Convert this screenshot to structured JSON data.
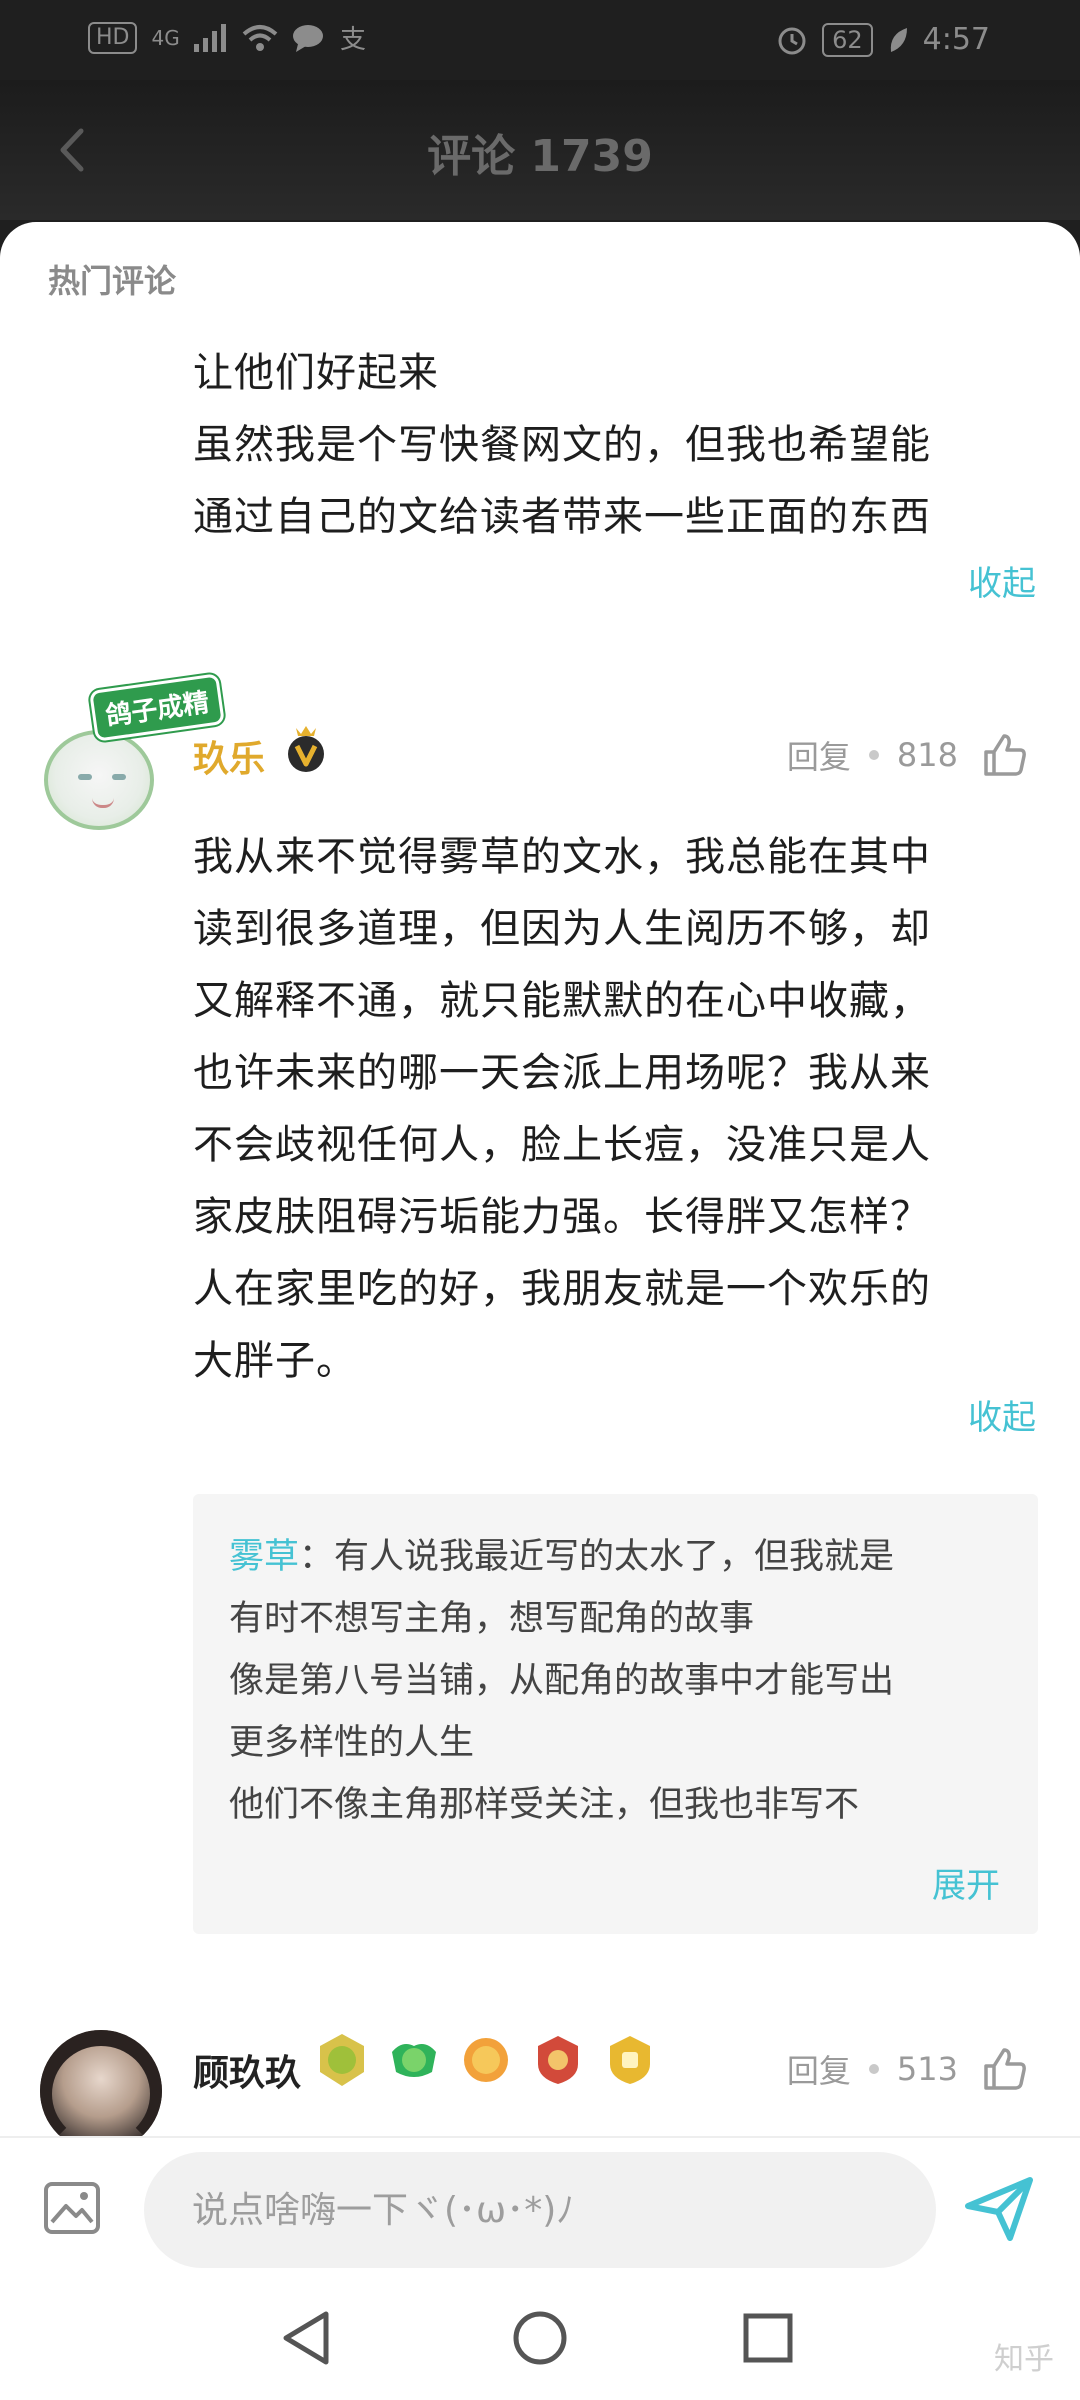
{
  "status_bar": {
    "hd_label": "HD",
    "network": "4G",
    "battery": "62",
    "time": "4:57"
  },
  "header": {
    "title": "评论 1739"
  },
  "section": {
    "hot_label": "热门评论"
  },
  "expanded_comment": {
    "lines": [
      "让他们好起来",
      "虽然我是个写快餐网文的，但我也希望能",
      "通过自己的文给读者带来一些正面的东西"
    ],
    "collapse_label": "收起"
  },
  "comment1": {
    "avatar_badge": "鸽子成精",
    "username": "玖乐",
    "reply_label": "回复",
    "likes": "818",
    "lines": [
      "我从来不觉得雾草的文水，我总能在其中",
      "读到很多道理，但因为人生阅历不够，却",
      "又解释不通，就只能默默的在心中收藏，",
      "也许未来的哪一天会派上用场呢？我从来",
      "不会歧视任何人，脸上长痘，没准只是人",
      "家皮肤阻碍污垢能力强。长得胖又怎样？",
      "人在家里吃的好，我朋友就是一个欢乐的",
      "大胖子。"
    ],
    "collapse_label": "收起",
    "reply": {
      "author": "雾草",
      "separator": "：",
      "first_line_text": "有人说我最近写的太水了，但我就是",
      "lines": [
        "有时不想写主角，想写配角的故事",
        "像是第八号当铺，从配角的故事中才能写出",
        "更多样性的人生",
        "他们不像主角那样受关注，但我也非写不"
      ],
      "expand_label": "展开"
    }
  },
  "comment2": {
    "username": "顾玖玖",
    "reply_label": "回复",
    "likes": "513",
    "level_badges": [
      "助力专家",
      "初出茅庐",
      "积分破亿",
      "达人",
      "勋章"
    ]
  },
  "input_bar": {
    "placeholder": "说点啥嗨一下ヾ(･ω･*)ﾉ"
  },
  "watermark": "知乎"
}
